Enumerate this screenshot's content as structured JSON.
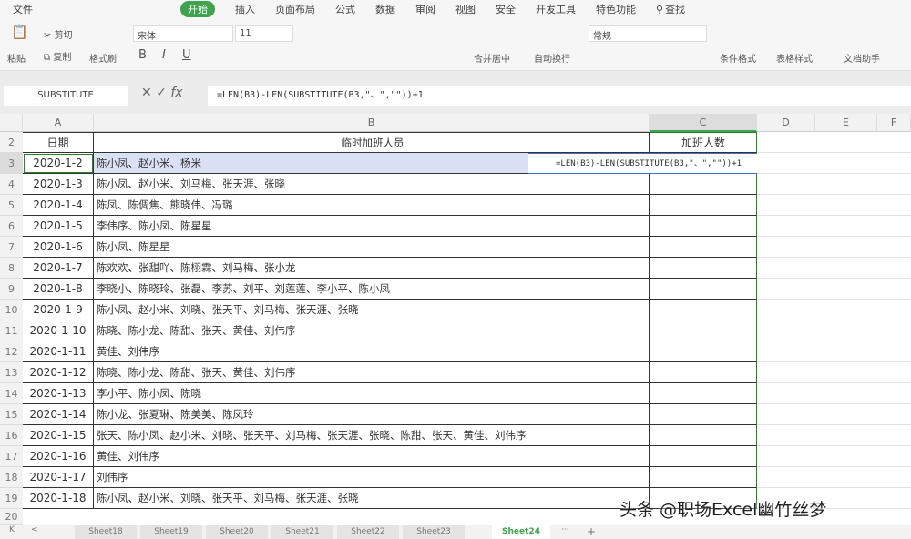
{
  "menu": {
    "file": "文件",
    "tabs": [
      "开始",
      "插入",
      "页面布局",
      "公式",
      "数据",
      "审阅",
      "视图",
      "安全",
      "开发工具",
      "特色功能"
    ],
    "search": "查找"
  },
  "ribbon": {
    "paste": "粘贴",
    "cut": "剪切",
    "copy": "复制",
    "format_painter": "格式刷",
    "font": "宋体",
    "size": "11",
    "merge": "合并居中",
    "wrap": "自动换行",
    "number_format": "常规",
    "cond_format": "条件格式",
    "table_style": "表格样式",
    "doc_helper": "文档助手"
  },
  "formula": {
    "name_box": "SUBSTITUTE",
    "fx": "fx",
    "content": "=LEN(B3)-LEN(SUBSTITUTE(B3,\"、\",\"\"))+1"
  },
  "columns": [
    "A",
    "B",
    "C",
    "D",
    "E",
    "F"
  ],
  "header": {
    "date": "日期",
    "people": "临时加班人员",
    "count": "加班人数"
  },
  "rows": [
    {
      "n": "3",
      "date": "2020-1-2",
      "people": "陈小凤、赵小米、杨米"
    },
    {
      "n": "4",
      "date": "2020-1-3",
      "people": "陈小凤、赵小米、刘马梅、张天涯、张晓"
    },
    {
      "n": "5",
      "date": "2020-1-4",
      "people": "陈凤、陈倜焦、熊晓伟、冯璐"
    },
    {
      "n": "6",
      "date": "2020-1-5",
      "people": "李伟序、陈小凤、陈星星"
    },
    {
      "n": "7",
      "date": "2020-1-6",
      "people": "陈小凤、陈星星"
    },
    {
      "n": "8",
      "date": "2020-1-7",
      "people": "陈欢欢、张甜吖、陈栩霖、刘马梅、张小龙"
    },
    {
      "n": "9",
      "date": "2020-1-8",
      "people": "李晓小、陈晓玲、张磊、李苏、刘平、刘莲莲、李小平、陈小凤"
    },
    {
      "n": "10",
      "date": "2020-1-9",
      "people": "陈小凤、赵小米、刘晓、张天平、刘马梅、张天涯、张晓"
    },
    {
      "n": "11",
      "date": "2020-1-10",
      "people": "陈晓、陈小龙、陈甜、张天、黄佳、刘伟序"
    },
    {
      "n": "12",
      "date": "2020-1-11",
      "people": "黄佳、刘伟序"
    },
    {
      "n": "13",
      "date": "2020-1-12",
      "people": "陈晓、陈小龙、陈甜、张天、黄佳、刘伟序"
    },
    {
      "n": "14",
      "date": "2020-1-13",
      "people": "李小平、陈小凤、陈晓"
    },
    {
      "n": "15",
      "date": "2020-1-14",
      "people": "陈小龙、张夏琳、陈美美、陈凤玲"
    },
    {
      "n": "16",
      "date": "2020-1-15",
      "people": "张天、陈小凤、赵小米、刘晓、张天平、刘马梅、张天涯、张晓、陈甜、张天、黄佳、刘伟序"
    },
    {
      "n": "17",
      "date": "2020-1-16",
      "people": "黄佳、刘伟序"
    },
    {
      "n": "18",
      "date": "2020-1-17",
      "people": "刘伟序"
    },
    {
      "n": "19",
      "date": "2020-1-18",
      "people": "陈小凤、赵小米、刘晓、张天平、刘马梅、张天涯、张晓"
    }
  ],
  "row_labels": {
    "r2": "2",
    "r20": "20"
  },
  "cell_formula": "=LEN(B3)-LEN(SUBSTITUTE(B3,\"、\",\"\"))+1",
  "sheets": [
    "Sheet18",
    "Sheet19",
    "Sheet20",
    "Sheet21",
    "Sheet22",
    "Sheet23",
    "Sheet24"
  ],
  "active_sheet": "Sheet24",
  "watermark": "头条 @职场Excel幽竹丝梦"
}
